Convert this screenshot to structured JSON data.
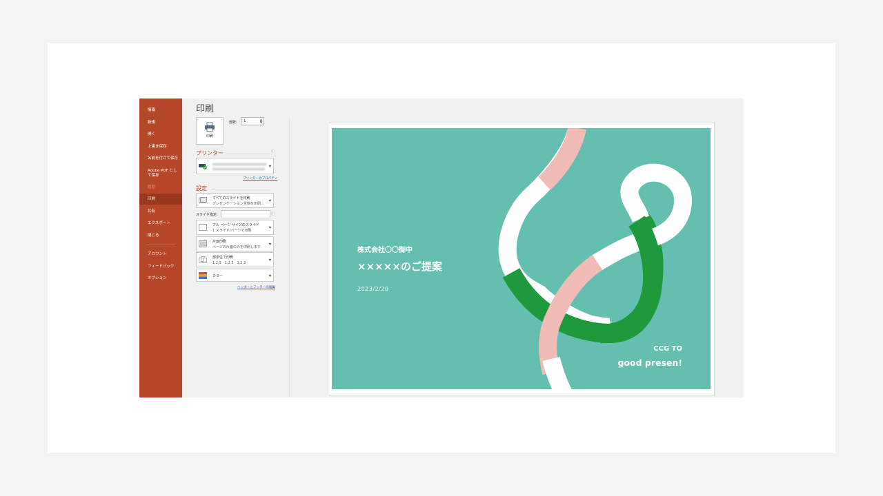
{
  "backstage": {
    "nav": [
      "情報",
      "新規",
      "開く",
      "上書き保存",
      "名前を付けて保存",
      "Adobe PDF として保存",
      "履歴",
      "印刷",
      "共有",
      "エクスポート",
      "閉じる",
      "アカウント",
      "フィードバック",
      "オプション"
    ],
    "selected_item": "印刷",
    "disabled_item": "履歴"
  },
  "print": {
    "title": "印刷",
    "print_button_label": "印刷",
    "copies_label": "部数:",
    "copies_value": "1",
    "printer_section": "プリンター",
    "printer_properties_link": "プリンターのプロパティ",
    "settings_section": "設定",
    "slides_label": "スライド指定:",
    "settings": [
      {
        "title": "すべてのスライドを印刷",
        "subtitle": "プレゼンテーション全体を印刷..."
      },
      {
        "title": "フル ページ サイズのスライド",
        "subtitle": "1 スライド/ページで印刷"
      },
      {
        "title": "片面印刷",
        "subtitle": "ページの片面のみを印刷します"
      },
      {
        "title": "部単位で印刷",
        "subtitle": "1,2,3　1,2,3　1,2,3"
      },
      {
        "title": "カラー",
        "subtitle": ""
      }
    ],
    "header_footer_link": "ヘッダーとフッターの編集"
  },
  "slide": {
    "company": "株式会社〇〇御中",
    "title": "×××××のご提案",
    "date": "2023/2/20",
    "ccg": "CCG TO",
    "good": "good presen!"
  },
  "colors": {
    "accent": "#b7472a",
    "slide_bg": "#64bfb1",
    "curve_white": "#ffffff",
    "curve_pink": "#f0bcb5",
    "curve_green": "#1e9a3c"
  }
}
